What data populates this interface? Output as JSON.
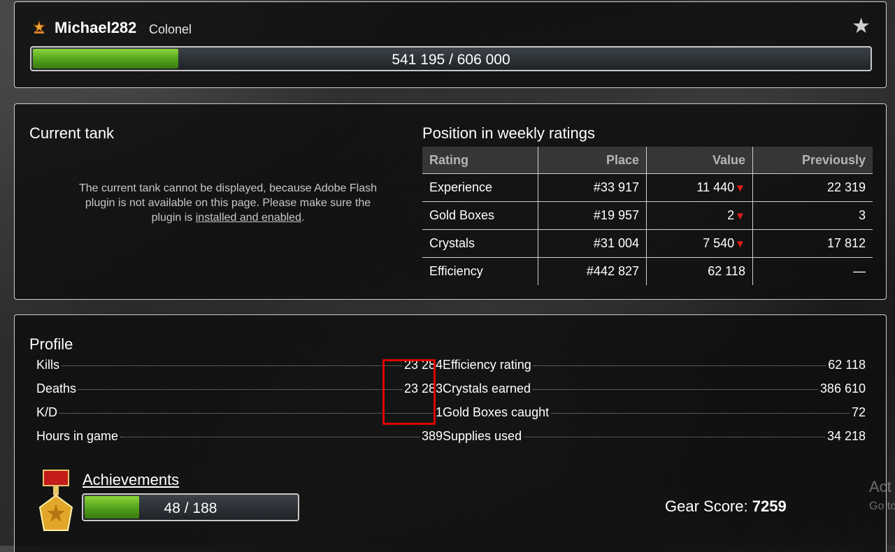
{
  "header": {
    "username": "Michael282",
    "rank": "Colonel",
    "xp_text": "541 195 / 606 000",
    "xp_progress": 0.173
  },
  "current_tank": {
    "title": "Current tank",
    "message_before": "The current tank cannot be displayed, because Adobe Flash plugin is not available on this page. Please make sure the plugin is ",
    "link_text": "installed and enabled",
    "message_after": "."
  },
  "ratings": {
    "title": "Position in weekly ratings",
    "columns": [
      "Rating",
      "Place",
      "Value",
      "Previously"
    ],
    "rows": [
      {
        "rating": "Experience",
        "place": "#33 917",
        "value": "11 440",
        "trend": "down",
        "previously": "22 319"
      },
      {
        "rating": "Gold Boxes",
        "place": "#19 957",
        "value": "2",
        "trend": "down",
        "previously": "3"
      },
      {
        "rating": "Crystals",
        "place": "#31 004",
        "value": "7 540",
        "trend": "down",
        "previously": "17 812"
      },
      {
        "rating": "Efficiency",
        "place": "#442 827",
        "value": "62 118",
        "trend": "",
        "previously": "—"
      }
    ]
  },
  "profile": {
    "title": "Profile",
    "left_stats": [
      {
        "label": "Kills",
        "value": "23 284"
      },
      {
        "label": "Deaths",
        "value": "23 283"
      },
      {
        "label": "K/D",
        "value": "1"
      },
      {
        "label": "Hours in game",
        "value": "389"
      }
    ],
    "right_stats": [
      {
        "label": "Efficiency rating",
        "value": "62 118"
      },
      {
        "label": "Crystals earned",
        "value": "386 610"
      },
      {
        "label": "Gold Boxes caught",
        "value": "72"
      },
      {
        "label": "Supplies used",
        "value": "34 218"
      }
    ],
    "achievements_label": "Achievements",
    "achievements_text": "48 / 188",
    "achievements_progress": 0.255,
    "gear_label": "Gear Score:",
    "gear_value": "7259"
  },
  "overlay": {
    "activate_text": "Act",
    "goto_text": "Go to"
  },
  "colors": {
    "accent_green": "#52a01b",
    "trend_down": "#e21c1c",
    "highlight_box": "#e00000"
  }
}
